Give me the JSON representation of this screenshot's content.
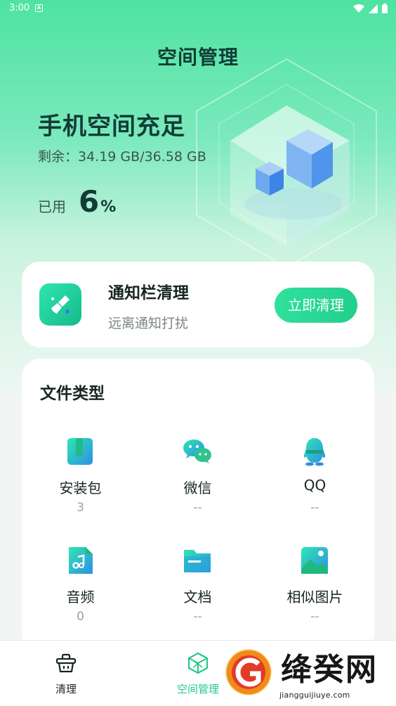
{
  "status_bar": {
    "time": "3:00",
    "notif_letter": "A"
  },
  "app": {
    "title": "空间管理"
  },
  "storage": {
    "status": "手机空间充足",
    "remaining_text": "剩余：34.19 GB/36.58 GB",
    "used_label": "已用",
    "used_value": "6",
    "used_unit": "%",
    "used_fraction": 0.06
  },
  "notify_card": {
    "title": "通知栏清理",
    "subtitle": "远离通知打扰",
    "button_label": "立即清理",
    "icon": "broom-icon"
  },
  "file_types": {
    "title": "文件类型",
    "items": [
      {
        "label": "安装包",
        "count": "3",
        "icon": "apk-package-icon"
      },
      {
        "label": "微信",
        "count": "--",
        "icon": "wechat-icon"
      },
      {
        "label": "QQ",
        "count": "--",
        "icon": "qq-icon"
      },
      {
        "label": "音频",
        "count": "0",
        "icon": "audio-file-icon"
      },
      {
        "label": "文档",
        "count": "--",
        "icon": "folder-document-icon"
      },
      {
        "label": "相似图片",
        "count": "--",
        "icon": "image-icon"
      }
    ]
  },
  "bottom_nav": {
    "items": [
      {
        "label": "清理",
        "icon": "basket-clean-icon",
        "active": false
      },
      {
        "label": "空间管理",
        "icon": "cube-space-icon",
        "active": true
      }
    ]
  },
  "watermark": {
    "text": "绛癸网",
    "url": "jiangguijiuye.com"
  },
  "colors": {
    "accent": "#22cf8b",
    "title_dark": "#123c36",
    "icon_blue": "#2f8ee6"
  }
}
